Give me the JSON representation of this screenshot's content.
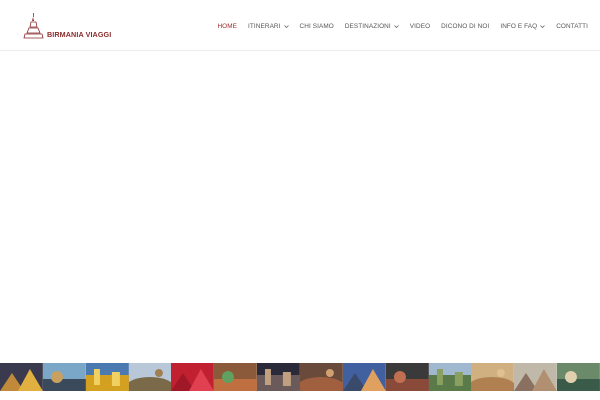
{
  "brand": {
    "name": "BIRMANIA VIAGGI",
    "logo_color": "#8a2b2b"
  },
  "nav": {
    "items": [
      {
        "key": "home",
        "label": "HOME",
        "active": true,
        "dropdown": false
      },
      {
        "key": "itinerari",
        "label": "ITINERARI",
        "active": false,
        "dropdown": true
      },
      {
        "key": "chi-siamo",
        "label": "CHI SIAMO",
        "active": false,
        "dropdown": false
      },
      {
        "key": "destinazioni",
        "label": "DESTINAZIONI",
        "active": false,
        "dropdown": true
      },
      {
        "key": "video",
        "label": "VIDEO",
        "active": false,
        "dropdown": false
      },
      {
        "key": "dicono-di-noi",
        "label": "DICONO DI NOI",
        "active": false,
        "dropdown": false
      },
      {
        "key": "info-e-faq",
        "label": "INFO E FAQ",
        "active": false,
        "dropdown": true
      },
      {
        "key": "contatti",
        "label": "CONTATTI",
        "active": false,
        "dropdown": false
      }
    ],
    "active_color": "#9b2d2d",
    "text_color": "#555555"
  },
  "photo_strip": {
    "tiles": [
      {
        "subject": "temple-dancers",
        "sky": "#3a3a4e",
        "main": "#c08a3a",
        "accent": "#e0b040"
      },
      {
        "subject": "lake-boats",
        "sky": "#7aa6c8",
        "main": "#3a4a5a",
        "accent": "#c8a060"
      },
      {
        "subject": "golden-pagoda",
        "sky": "#4a7ab0",
        "main": "#d4a020",
        "accent": "#f0d060"
      },
      {
        "subject": "bagan-plains",
        "sky": "#b8c8d8",
        "main": "#7a6a4a",
        "accent": "#a08050"
      },
      {
        "subject": "red-robes",
        "sky": "#c02030",
        "main": "#a01828",
        "accent": "#e04050"
      },
      {
        "subject": "market-basket",
        "sky": "#8a5a3a",
        "main": "#c07040",
        "accent": "#60a060"
      },
      {
        "subject": "crowd-night",
        "sky": "#2a2a3a",
        "main": "#6a5a5a",
        "accent": "#c0a080"
      },
      {
        "subject": "market-stalls",
        "sky": "#6a4a3a",
        "main": "#a06040",
        "accent": "#d0a070"
      },
      {
        "subject": "mountain-sunset",
        "sky": "#4060a0",
        "main": "#3a4a6a",
        "accent": "#e0a060"
      },
      {
        "subject": "village-people",
        "sky": "#3a3a3a",
        "main": "#8a4a3a",
        "accent": "#c07050"
      },
      {
        "subject": "green-valley",
        "sky": "#a0b8d0",
        "main": "#5a7a4a",
        "accent": "#8aa060"
      },
      {
        "subject": "river-workers",
        "sky": "#d0b080",
        "main": "#b08050",
        "accent": "#e0c090"
      },
      {
        "subject": "dusty-field",
        "sky": "#c0b8a8",
        "main": "#8a7060",
        "accent": "#b09070"
      },
      {
        "subject": "travellers-group",
        "sky": "#6a8a6a",
        "main": "#3a5a4a",
        "accent": "#e0d0b0"
      }
    ]
  }
}
